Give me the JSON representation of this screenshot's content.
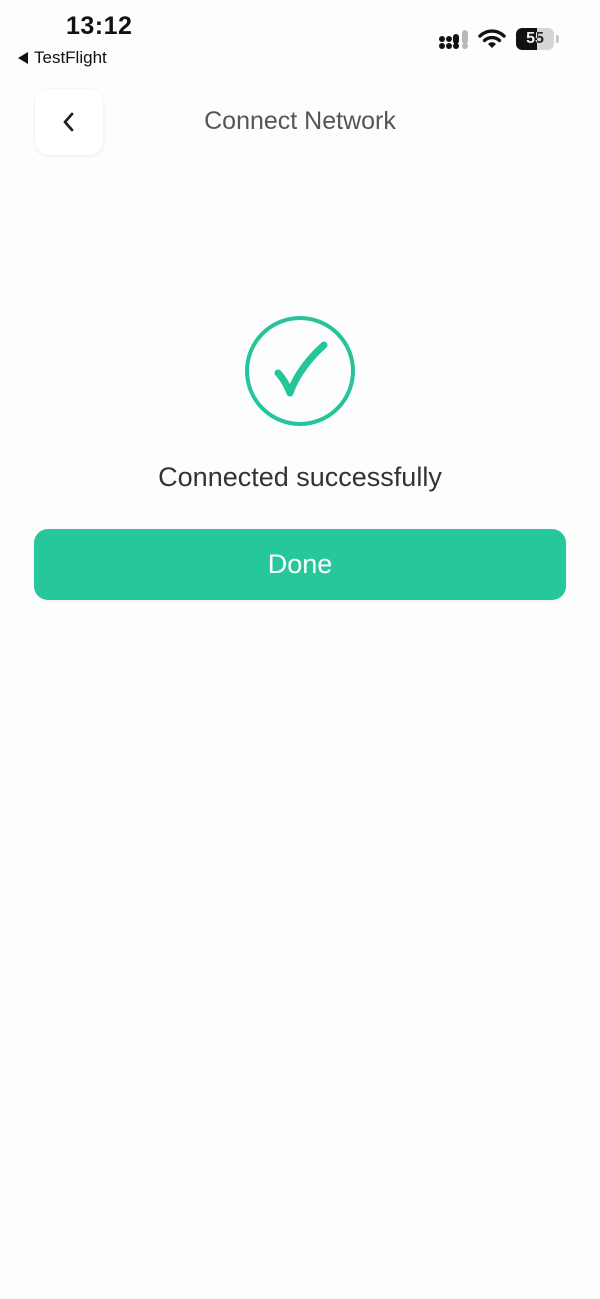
{
  "status_bar": {
    "time": "13:12",
    "back_app_label": "TestFlight",
    "battery_level": "55",
    "icons": [
      "signal-icon",
      "wifi-icon",
      "battery-icon"
    ]
  },
  "header": {
    "title": "Connect Network",
    "back_icon": "chevron-left-icon"
  },
  "result": {
    "icon": "check-circle-icon",
    "message": "Connected successfully"
  },
  "actions": {
    "done_label": "Done"
  },
  "colors": {
    "accent": "#26c79b",
    "check": "#25c49a",
    "title_text": "#555555",
    "body_text": "#333333",
    "background": "#fdfdfd"
  }
}
